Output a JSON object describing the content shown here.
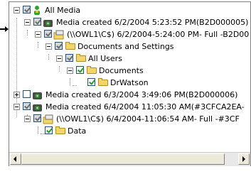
{
  "tree": {
    "root": {
      "label": "All Media",
      "icon": "person-icon",
      "expander": "minus",
      "check": "partial"
    },
    "nodes": [
      {
        "label": "Media created 6/2/2004 5:23:52 PM(B2D000005)",
        "icon": "media-icon",
        "expander": "minus",
        "check": "partial"
      },
      {
        "label": "(\\\\OWL1\\C$) 6/2/2004-5:24:00 PM- Full -B2D00",
        "icon": "backup-set-icon",
        "expander": "minus",
        "check": "partial"
      },
      {
        "label": "Documents and Settings",
        "icon": "folder-icon",
        "expander": "minus",
        "check": "partial"
      },
      {
        "label": "All Users",
        "icon": "folder-icon",
        "expander": "minus",
        "check": "partial"
      },
      {
        "label": "Documents",
        "icon": "folder-icon",
        "expander": "minus",
        "check": "checked"
      },
      {
        "label": "DrWatson",
        "icon": "folder-icon",
        "expander": "none",
        "check": "checked"
      },
      {
        "label": "Media created 6/3/2004 3:49:06 PM(B2D000006)",
        "icon": "media-icon",
        "expander": "plus",
        "check": "unchecked"
      },
      {
        "label": "Media created 6/4/2004 11:05:30 AM(#3CFCA2EA-",
        "icon": "media-icon",
        "expander": "minus",
        "check": "partial"
      },
      {
        "label": "(\\\\OWL1\\C$) 6/4/2004-11:06:54 AM- Full -#3CF",
        "icon": "backup-set-icon",
        "expander": "minus",
        "check": "partial"
      },
      {
        "label": "Data",
        "icon": "folder-icon",
        "expander": "none",
        "check": "checked"
      }
    ]
  },
  "colors": {
    "checkmark": "#21a121",
    "folder": "#f3d66b",
    "panel_border": "#7f7f7f"
  }
}
